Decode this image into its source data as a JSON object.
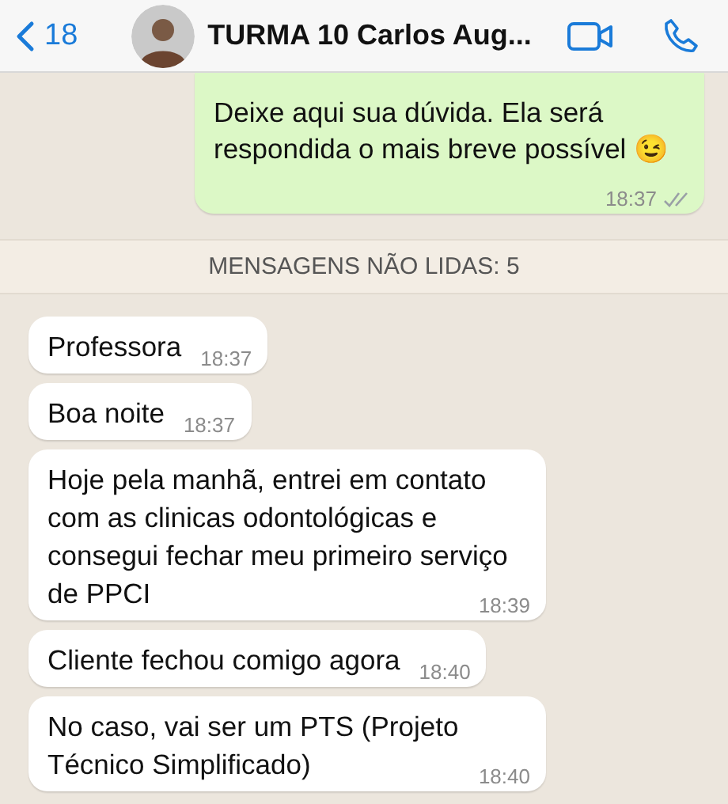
{
  "header": {
    "back_count": "18",
    "title": "TURMA 10 Carlos Aug..."
  },
  "messages": [
    {
      "kind": "out",
      "text": "Deixe aqui sua dúvida. Ela será respondida o mais breve possível 😉",
      "time": "18:37",
      "read": false
    },
    {
      "kind": "divider",
      "text": "MENSAGENS NÃO LIDAS: 5"
    },
    {
      "kind": "in",
      "text": "Professora",
      "time": "18:37"
    },
    {
      "kind": "in",
      "text": "Boa noite",
      "time": "18:37"
    },
    {
      "kind": "in",
      "text": "Hoje pela manhã, entrei em contato com as clinicas odontológicas e consegui fechar meu primeiro serviço de PPCI",
      "time": "18:39"
    },
    {
      "kind": "in",
      "text": "Cliente fechou comigo agora",
      "time": "18:40"
    },
    {
      "kind": "in",
      "text": "No caso, vai ser um PTS (Projeto Técnico Simplificado)",
      "time": "18:40"
    }
  ]
}
